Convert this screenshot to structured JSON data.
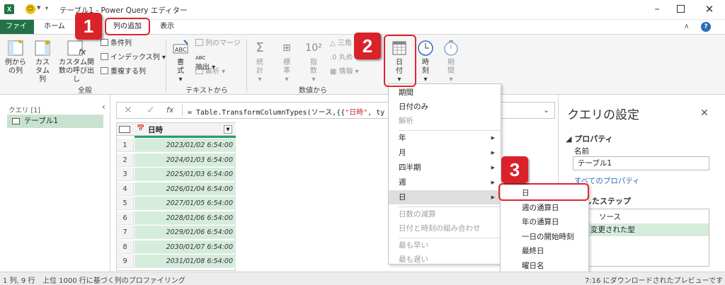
{
  "window": {
    "title": "テーブル1 - Power Query エディター"
  },
  "tabs": [
    "ファイル",
    "ホーム",
    "列の追加",
    "表示"
  ],
  "ribbon": {
    "col_from_examples": "例からの列",
    "custom_col": "カスタム列",
    "invoke_fn": "カスタム関数の呼び出し",
    "cond_col": "条件列",
    "index_col": "インデックス列",
    "dup_col": "重複する列",
    "group_general": "全般",
    "format": "書式",
    "merge_cols": "列のマージ",
    "extract": "抽出",
    "parse": "解析",
    "group_text": "テキストから",
    "stats": "統計",
    "standard": "標準",
    "scientific": "指数",
    "trig": "三角",
    "rounding": "丸め",
    "info": "情報",
    "group_number": "数値から",
    "date": "日付",
    "time": "時刻",
    "duration": "期間"
  },
  "query_pane": {
    "header": "クエリ [1]",
    "item": "テーブル1"
  },
  "formula": {
    "fx": "fx",
    "text_pre": "= Table.TransformColumnTypes(ソース,{{",
    "text_red": "\"日時\"",
    "text_post": ", ty"
  },
  "table": {
    "column": "日時",
    "rows": [
      {
        "n": "1",
        "v": "2023/01/02 6:54:00"
      },
      {
        "n": "2",
        "v": "2024/01/03 6:54:00"
      },
      {
        "n": "3",
        "v": "2025/01/03 6:54:00"
      },
      {
        "n": "4",
        "v": "2026/01/04 6:54:00"
      },
      {
        "n": "5",
        "v": "2027/01/05 6:54:00"
      },
      {
        "n": "6",
        "v": "2028/01/06 6:54:00"
      },
      {
        "n": "7",
        "v": "2029/01/06 6:54:00"
      },
      {
        "n": "8",
        "v": "2030/01/07 6:54:00"
      },
      {
        "n": "9",
        "v": "2031/01/08 6:54:00"
      }
    ]
  },
  "date_menu": {
    "items": [
      "期間",
      "日付のみ",
      "解析",
      "年",
      "月",
      "四半期",
      "週",
      "日",
      "日数の減算",
      "日付と時刻の組み合わせ",
      "最も早い",
      "最も遅い"
    ]
  },
  "day_submenu": {
    "items": [
      "日",
      "週の通算日",
      "年の通算日",
      "一日の開始時刻",
      "最終日",
      "曜日名"
    ]
  },
  "settings": {
    "title": "クエリの設定",
    "properties": "プロパティ",
    "name_label": "名前",
    "name_value": "テーブル1",
    "all_props": "すべてのプロパティ",
    "steps_title": "したステップ",
    "step1": "ソース",
    "step2": "変更された型"
  },
  "status": {
    "left": "1 列, 9 行",
    "profile": "上位 1000 行に基づく列のプロファイリング",
    "right": "7:16 にダウンロードされたプレビューです"
  },
  "badges": {
    "b1": "1",
    "b2": "2",
    "b3": "3"
  },
  "colors": {
    "excel_green": "#217346",
    "highlight_red": "#e0242c",
    "selected_green": "#d5ecdd"
  }
}
